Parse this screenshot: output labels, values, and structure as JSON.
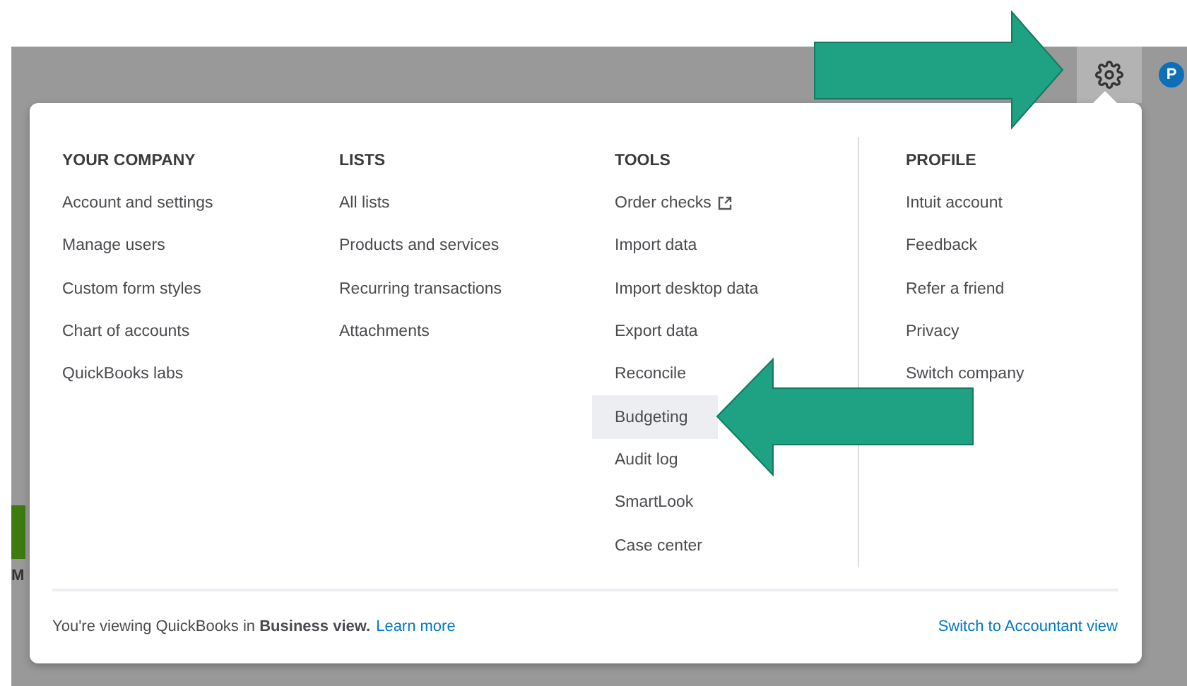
{
  "header": {
    "avatar": "P"
  },
  "background": {
    "label": "M"
  },
  "menu": {
    "columns": [
      {
        "heading": "YOUR COMPANY",
        "items": [
          {
            "label": "Account and settings",
            "selected": false
          },
          {
            "label": "Manage users",
            "selected": false
          },
          {
            "label": "Custom form styles",
            "selected": false
          },
          {
            "label": "Chart of accounts",
            "selected": false
          },
          {
            "label": "QuickBooks labs",
            "selected": false
          }
        ]
      },
      {
        "heading": "LISTS",
        "items": [
          {
            "label": "All lists",
            "selected": false
          },
          {
            "label": "Products and services",
            "selected": false
          },
          {
            "label": "Recurring transactions",
            "selected": false
          },
          {
            "label": "Attachments",
            "selected": false
          }
        ]
      },
      {
        "heading": "TOOLS",
        "items": [
          {
            "label": "Order checks",
            "selected": false,
            "external": true
          },
          {
            "label": "Import data",
            "selected": false
          },
          {
            "label": "Import desktop data",
            "selected": false
          },
          {
            "label": "Export data",
            "selected": false
          },
          {
            "label": "Reconcile",
            "selected": false
          },
          {
            "label": "Budgeting",
            "selected": true
          },
          {
            "label": "Audit log",
            "selected": false
          },
          {
            "label": "SmartLook",
            "selected": false
          },
          {
            "label": "Case center",
            "selected": false
          }
        ]
      },
      {
        "heading": "PROFILE",
        "items": [
          {
            "label": "Intuit account",
            "selected": false
          },
          {
            "label": "Feedback",
            "selected": false
          },
          {
            "label": "Refer a friend",
            "selected": false
          },
          {
            "label": "Privacy",
            "selected": false
          },
          {
            "label": "Switch company",
            "selected": false
          }
        ]
      }
    ],
    "footer": {
      "note": "You're viewing QuickBooks in **Business view.**",
      "link": "Learn more",
      "switch_link": "Switch to Accountant view"
    }
  }
}
